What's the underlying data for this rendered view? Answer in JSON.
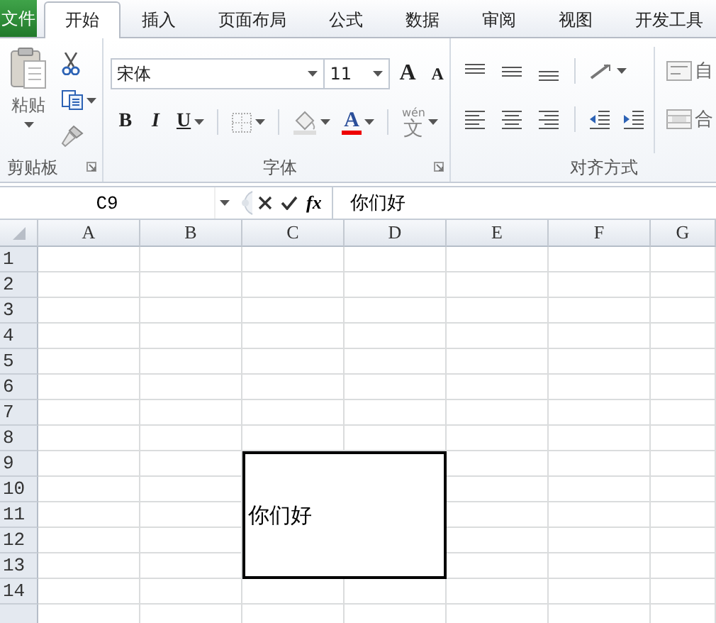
{
  "tabs": [
    {
      "label": "文件",
      "kind": "file",
      "selected": false
    },
    {
      "label": "开始",
      "kind": "tab",
      "selected": true
    },
    {
      "label": "插入",
      "kind": "tab",
      "selected": false
    },
    {
      "label": "页面布局",
      "kind": "tab",
      "selected": false
    },
    {
      "label": "公式",
      "kind": "tab",
      "selected": false
    },
    {
      "label": "数据",
      "kind": "tab",
      "selected": false
    },
    {
      "label": "审阅",
      "kind": "tab",
      "selected": false
    },
    {
      "label": "视图",
      "kind": "tab",
      "selected": false
    },
    {
      "label": "开发工具",
      "kind": "tab",
      "selected": false
    }
  ],
  "ribbon": {
    "clipboard": {
      "title": "剪贴板",
      "paste": "粘贴"
    },
    "font": {
      "title": "字体",
      "font_name": "宋体",
      "font_size": "11",
      "grow": "A",
      "shrink": "A",
      "bold": "B",
      "italic": "I",
      "underline": "U",
      "font_color": "A",
      "phonetic_hint": "wén",
      "phonetic": "文"
    },
    "alignment": {
      "title": "对齐方式",
      "wrap_text": "自",
      "merge": "合"
    }
  },
  "formula_bar": {
    "name_box": "C9",
    "fx": "fx",
    "content": "你们好"
  },
  "sheet": {
    "columns": [
      "A",
      "B",
      "C",
      "D",
      "E",
      "F",
      "G"
    ],
    "rows": [
      {
        "label": "1"
      },
      {
        "label": "2"
      },
      {
        "label": "3"
      },
      {
        "label": "4"
      },
      {
        "label": "5"
      },
      {
        "label": "6"
      },
      {
        "label": "7"
      },
      {
        "label": "8"
      },
      {
        "label": "9",
        "merged_cell": {
          "text": "你们好",
          "selected": true
        }
      },
      {
        "label": "10"
      },
      {
        "label": "11"
      },
      {
        "label": "12"
      },
      {
        "label": "13"
      },
      {
        "label": "14"
      }
    ]
  }
}
